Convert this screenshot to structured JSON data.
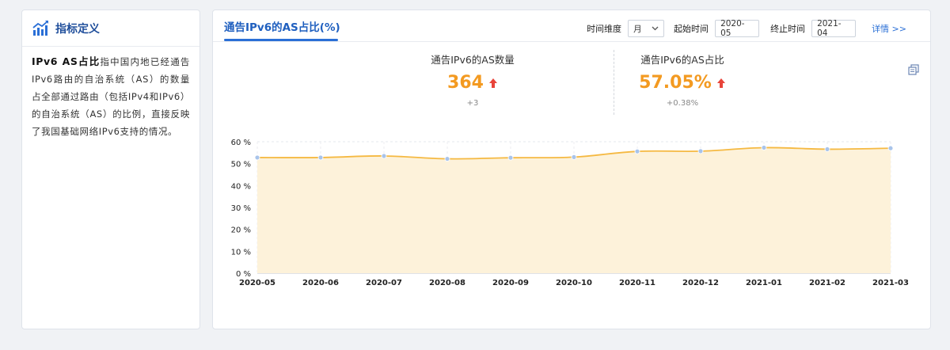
{
  "definition": {
    "title": "指标定义",
    "term": "IPv6 AS占比",
    "text": "指中国内地已经通告IPv6路由的自治系统（AS）的数量占全部通过路由（包括IPv4和IPv6）的自治系统（AS）的比例，直接反映了我国基础网络IPv6支持的情况。"
  },
  "panel": {
    "tab_title": "通告IPv6的AS占比(%)",
    "controls": {
      "time_dim_label": "时间维度",
      "time_dim_value": "月",
      "start_label": "起始时间",
      "start_value": "2020-05",
      "end_label": "终止时间",
      "end_value": "2021-04",
      "details": "详情 >>"
    },
    "kpis": [
      {
        "title": "通告IPv6的AS数量",
        "value": "364",
        "delta": "+3"
      },
      {
        "title": "通告IPv6的AS占比",
        "value": "57.05%",
        "delta": "+0.38%"
      }
    ]
  },
  "colors": {
    "accent": "#f39a21",
    "line": "#f5b942",
    "area": "#fdf2da",
    "marker": "#a9c4ea",
    "up_arrow": "#e8443a",
    "brand": "#1f5fbf"
  },
  "chart_data": {
    "type": "area",
    "x": [
      "2020-05",
      "2020-06",
      "2020-07",
      "2020-08",
      "2020-09",
      "2020-10",
      "2020-11",
      "2020-12",
      "2021-01",
      "2021-02",
      "2021-03"
    ],
    "series": [
      {
        "values": [
          52.8,
          52.8,
          53.5,
          52.2,
          52.7,
          53.0,
          55.6,
          55.7,
          57.3,
          56.6,
          57.05
        ]
      }
    ],
    "yticks": [
      "0 %",
      "10 %",
      "20 %",
      "30 %",
      "40 %",
      "50 %",
      "60 %"
    ],
    "ylim": [
      0,
      60
    ],
    "grid": true
  }
}
